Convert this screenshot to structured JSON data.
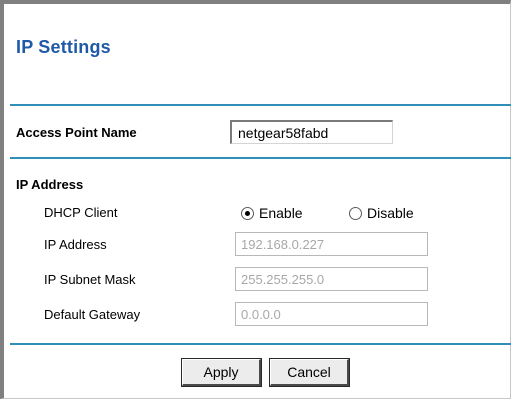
{
  "page": {
    "title": "IP Settings"
  },
  "access_point": {
    "label": "Access Point Name",
    "value": "netgear58fabd"
  },
  "ip_address_section": {
    "heading": "IP Address",
    "dhcp_client": {
      "label": "DHCP Client",
      "options": [
        "Enable",
        "Disable"
      ],
      "selected": "Enable"
    },
    "ip_address": {
      "label": "IP Address",
      "value": "192.168.0.227"
    },
    "subnet_mask": {
      "label": "IP Subnet Mask",
      "value": "255.255.255.0"
    },
    "default_gateway": {
      "label": "Default Gateway",
      "value": "0.0.0.0"
    }
  },
  "buttons": {
    "apply": "Apply",
    "cancel": "Cancel"
  },
  "colors": {
    "title": "#1f5aa8",
    "divider": "#2f8fb6",
    "disabled_text": "#a8a8a8"
  }
}
